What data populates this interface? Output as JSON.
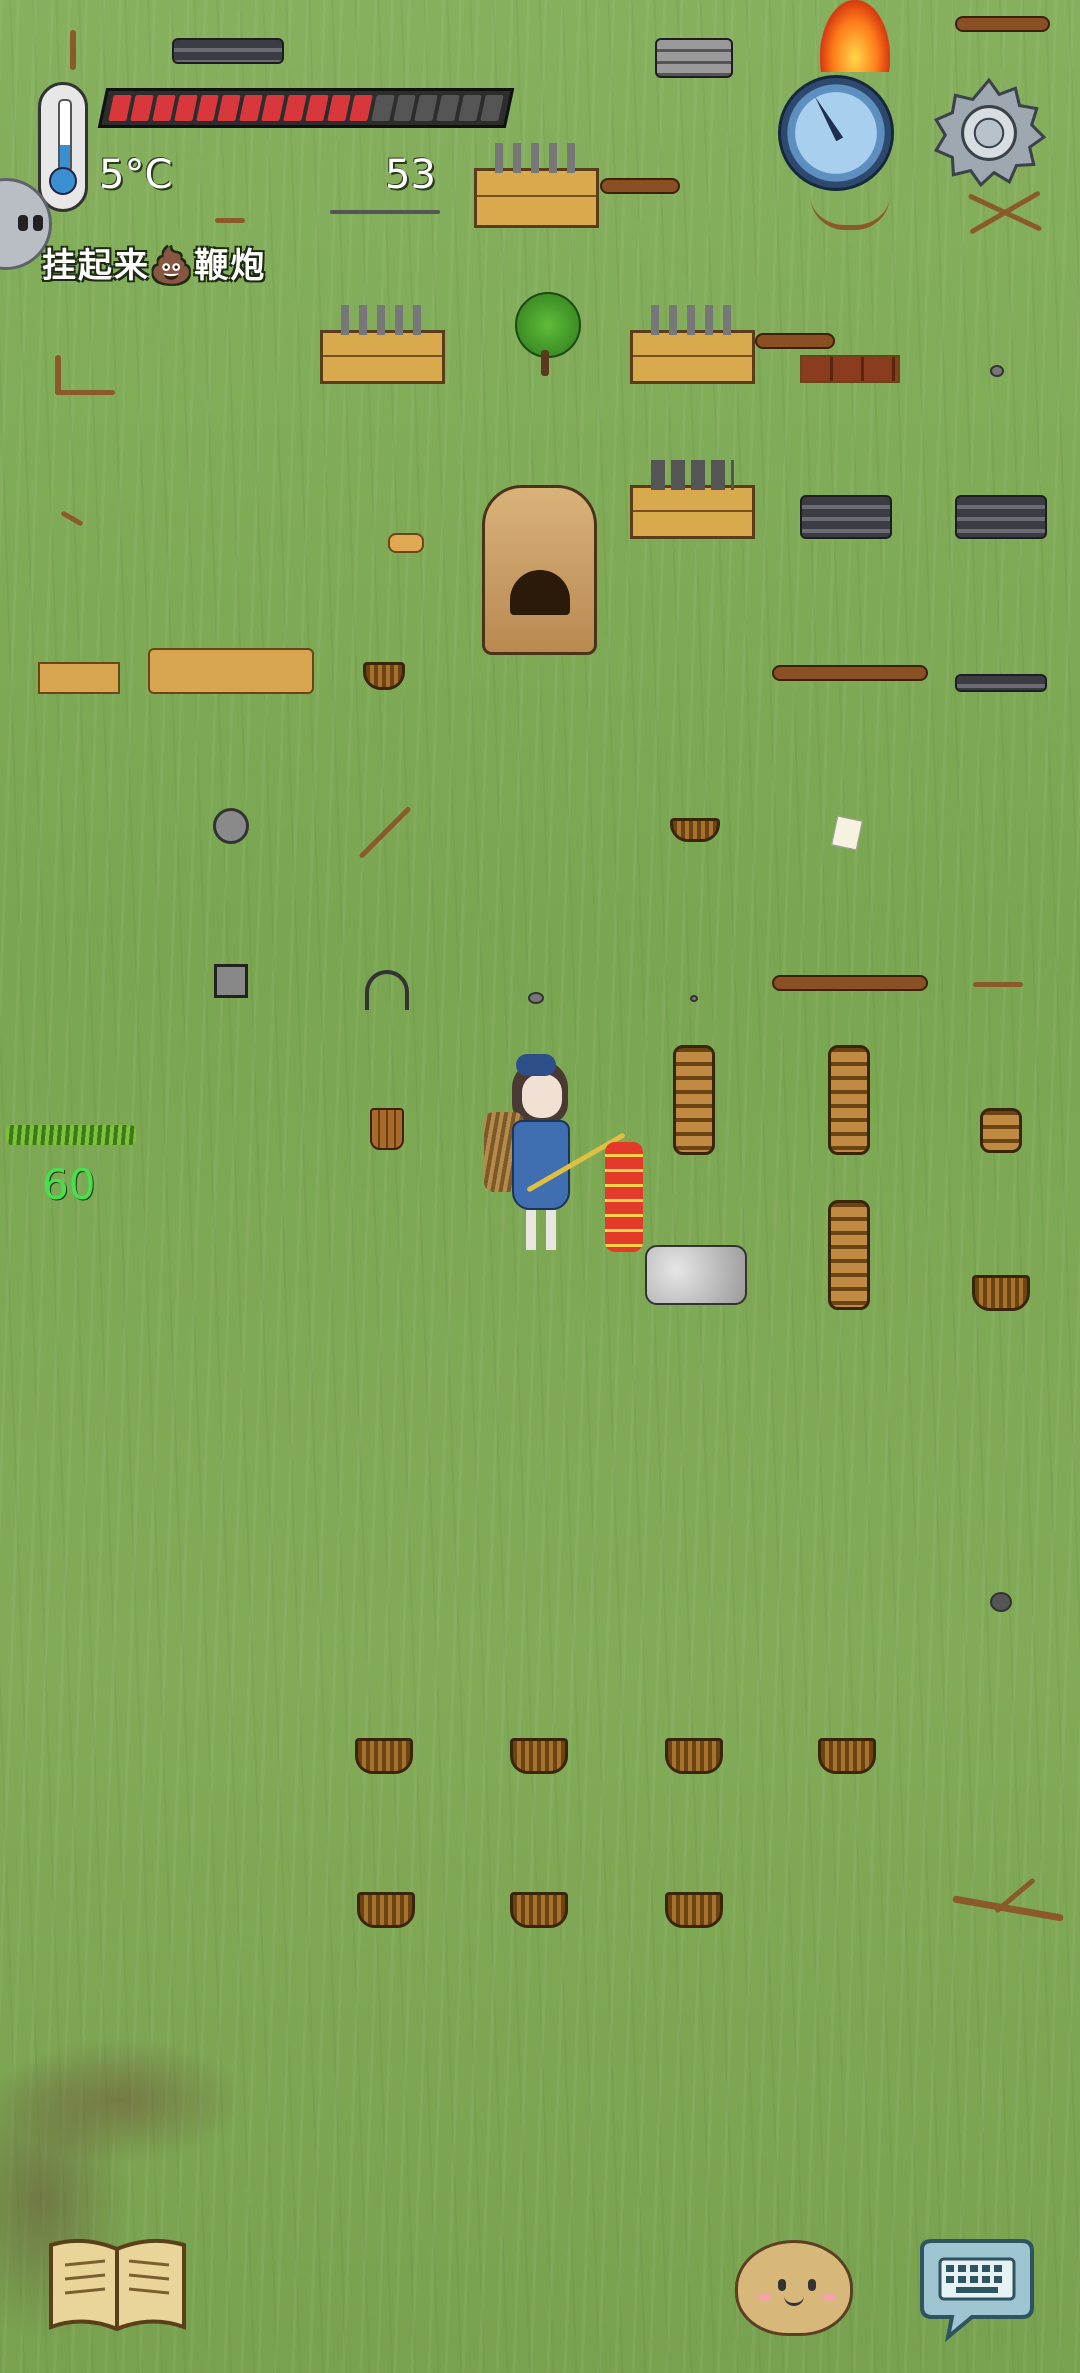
{
  "hud": {
    "temperature": "5°C",
    "food_bar": {
      "segments_total": 18,
      "segments_filled": 12,
      "color_filled": "#d8383c",
      "color_empty": "#555555"
    },
    "yum_count": "53",
    "task": "挂起来💩鞭炮",
    "held_item_count": "60",
    "icons": {
      "thermometer": "thermometer-icon",
      "compass": "compass-icon",
      "settings": "gear-icon",
      "profile": "profile-face-icon",
      "book": "tech-book-icon",
      "emote": "emote-face-icon",
      "keyboard": "chat-keyboard-icon"
    }
  }
}
